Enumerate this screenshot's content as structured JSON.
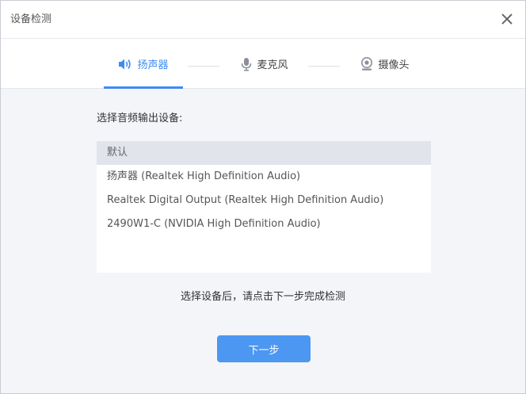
{
  "window": {
    "title": "设备检测"
  },
  "tabs": [
    {
      "label": "扬声器",
      "icon": "speaker-icon",
      "active": true
    },
    {
      "label": "麦克风",
      "icon": "microphone-icon",
      "active": false
    },
    {
      "label": "摄像头",
      "icon": "camera-icon",
      "active": false
    }
  ],
  "content": {
    "select_label": "选择音频输出设备:",
    "devices": [
      {
        "name": "默认",
        "selected": true
      },
      {
        "name": "扬声器 (Realtek High Definition Audio)",
        "selected": false
      },
      {
        "name": "Realtek Digital Output (Realtek High Definition Audio)",
        "selected": false
      },
      {
        "name": "2490W1-C (NVIDIA High Definition Audio)",
        "selected": false
      }
    ],
    "hint": "选择设备后，请点击下一步完成检测",
    "next_label": "下一步"
  },
  "colors": {
    "accent": "#3e8cf0",
    "button": "#4b97f2",
    "selected_row": "#e1e4ea"
  }
}
